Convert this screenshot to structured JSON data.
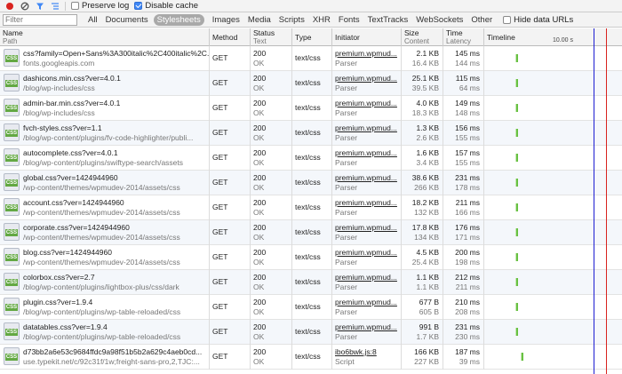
{
  "toolbar": {
    "preserve_log_label": "Preserve log",
    "preserve_log_checked": false,
    "disable_cache_label": "Disable cache",
    "disable_cache_checked": true
  },
  "filter": {
    "placeholder": "Filter",
    "types": [
      "All",
      "Documents",
      "Stylesheets",
      "Images",
      "Media",
      "Scripts",
      "XHR",
      "Fonts",
      "TextTracks",
      "WebSockets",
      "Other"
    ],
    "active_type": "Stylesheets",
    "hide_data_urls_label": "Hide data URLs",
    "hide_data_urls_checked": false
  },
  "columns": {
    "name": "Name",
    "path": "Path",
    "method": "Method",
    "status": "Status",
    "text": "Text",
    "type": "Type",
    "initiator": "Initiator",
    "size": "Size",
    "content": "Content",
    "time": "Time",
    "latency": "Latency",
    "timeline": "Timeline",
    "timeline_scale": "10.00 s"
  },
  "icon_label": "CSS",
  "colors": {
    "accent_blue": "#3f87f5",
    "timeline_blue": "#1d1dd2",
    "timeline_red": "#d9231f",
    "bar_green": "#68c142",
    "record_red": "#d9231f"
  },
  "rows": [
    {
      "name": "css?family=Open+Sans%3A300italic%2C400italic%2C...",
      "path": "fonts.googleapis.com",
      "method": "GET",
      "status": "200",
      "status_text": "OK",
      "type": "text/css",
      "initiator": "premium.wpmud...",
      "initiator_type": "Parser",
      "size": "2.1 KB",
      "content": "16.4 KB",
      "time": "145 ms",
      "latency": "144 ms"
    },
    {
      "name": "dashicons.min.css?ver=4.0.1",
      "path": "/blog/wp-includes/css",
      "method": "GET",
      "status": "200",
      "status_text": "OK",
      "type": "text/css",
      "initiator": "premium.wpmud...",
      "initiator_type": "Parser",
      "size": "25.1 KB",
      "content": "39.5 KB",
      "time": "115 ms",
      "latency": "64 ms"
    },
    {
      "name": "admin-bar.min.css?ver=4.0.1",
      "path": "/blog/wp-includes/css",
      "method": "GET",
      "status": "200",
      "status_text": "OK",
      "type": "text/css",
      "initiator": "premium.wpmud...",
      "initiator_type": "Parser",
      "size": "4.0 KB",
      "content": "18.3 KB",
      "time": "149 ms",
      "latency": "148 ms"
    },
    {
      "name": "fvch-styles.css?ver=1.1",
      "path": "/blog/wp-content/plugins/fv-code-highlighter/publi...",
      "method": "GET",
      "status": "200",
      "status_text": "OK",
      "type": "text/css",
      "initiator": "premium.wpmud...",
      "initiator_type": "Parser",
      "size": "1.3 KB",
      "content": "2.6 KB",
      "time": "156 ms",
      "latency": "155 ms"
    },
    {
      "name": "autocomplete.css?ver=4.0.1",
      "path": "/blog/wp-content/plugins/swiftype-search/assets",
      "method": "GET",
      "status": "200",
      "status_text": "OK",
      "type": "text/css",
      "initiator": "premium.wpmud...",
      "initiator_type": "Parser",
      "size": "1.6 KB",
      "content": "3.4 KB",
      "time": "157 ms",
      "latency": "155 ms"
    },
    {
      "name": "global.css?ver=1424944960",
      "path": "/wp-content/themes/wpmudev-2014/assets/css",
      "method": "GET",
      "status": "200",
      "status_text": "OK",
      "type": "text/css",
      "initiator": "premium.wpmud...",
      "initiator_type": "Parser",
      "size": "38.6 KB",
      "content": "266 KB",
      "time": "231 ms",
      "latency": "178 ms"
    },
    {
      "name": "account.css?ver=1424944960",
      "path": "/wp-content/themes/wpmudev-2014/assets/css",
      "method": "GET",
      "status": "200",
      "status_text": "OK",
      "type": "text/css",
      "initiator": "premium.wpmud...",
      "initiator_type": "Parser",
      "size": "18.2 KB",
      "content": "132 KB",
      "time": "211 ms",
      "latency": "166 ms"
    },
    {
      "name": "corporate.css?ver=1424944960",
      "path": "/wp-content/themes/wpmudev-2014/assets/css",
      "method": "GET",
      "status": "200",
      "status_text": "OK",
      "type": "text/css",
      "initiator": "premium.wpmud...",
      "initiator_type": "Parser",
      "size": "17.8 KB",
      "content": "134 KB",
      "time": "176 ms",
      "latency": "171 ms"
    },
    {
      "name": "blog.css?ver=1424944960",
      "path": "/wp-content/themes/wpmudev-2014/assets/css",
      "method": "GET",
      "status": "200",
      "status_text": "OK",
      "type": "text/css",
      "initiator": "premium.wpmud...",
      "initiator_type": "Parser",
      "size": "4.5 KB",
      "content": "25.4 KB",
      "time": "200 ms",
      "latency": "198 ms"
    },
    {
      "name": "colorbox.css?ver=2.7",
      "path": "/blog/wp-content/plugins/lightbox-plus/css/dark",
      "method": "GET",
      "status": "200",
      "status_text": "OK",
      "type": "text/css",
      "initiator": "premium.wpmud...",
      "initiator_type": "Parser",
      "size": "1.1 KB",
      "content": "1.1 KB",
      "time": "212 ms",
      "latency": "211 ms"
    },
    {
      "name": "plugin.css?ver=1.9.4",
      "path": "/blog/wp-content/plugins/wp-table-reloaded/css",
      "method": "GET",
      "status": "200",
      "status_text": "OK",
      "type": "text/css",
      "initiator": "premium.wpmud...",
      "initiator_type": "Parser",
      "size": "677 B",
      "content": "605 B",
      "time": "210 ms",
      "latency": "208 ms"
    },
    {
      "name": "datatables.css?ver=1.9.4",
      "path": "/blog/wp-content/plugins/wp-table-reloaded/css",
      "method": "GET",
      "status": "200",
      "status_text": "OK",
      "type": "text/css",
      "initiator": "premium.wpmud...",
      "initiator_type": "Parser",
      "size": "991 B",
      "content": "1.7 KB",
      "time": "231 ms",
      "latency": "230 ms"
    },
    {
      "name": "d73bb2a6e53c9684ffdc9a98f51b5b2a629c4aeb0cd...",
      "path": "use.typekit.net/c/92c31f/1w;freight-sans-pro,2,TJC:...",
      "method": "GET",
      "status": "200",
      "status_text": "OK",
      "type": "text/css",
      "initiator": "ibo6bwk.js:8",
      "initiator_type": "Script",
      "size": "166 KB",
      "content": "227 KB",
      "time": "187 ms",
      "latency": "39 ms"
    }
  ]
}
